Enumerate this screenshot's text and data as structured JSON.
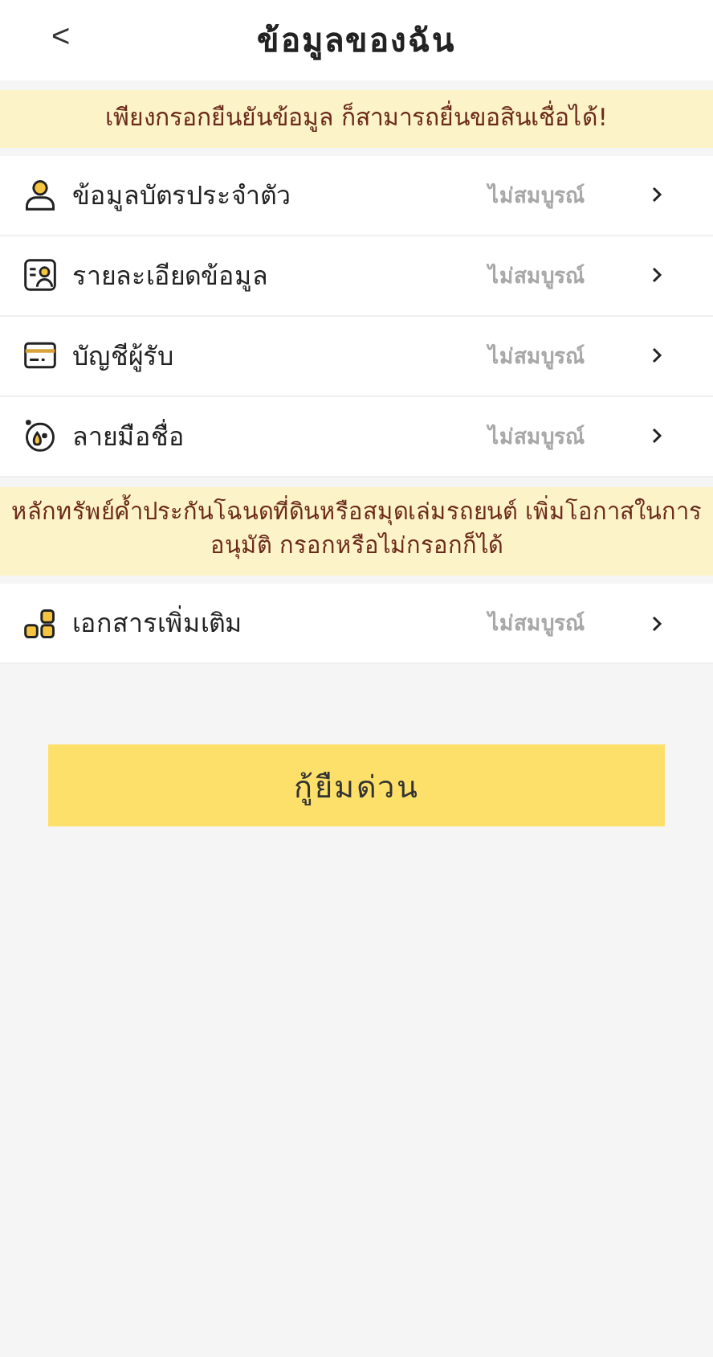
{
  "header": {
    "back": "<",
    "title": "ข้อมูลของฉัน"
  },
  "notice": "เพียงกรอกยืนยันข้อมูล ก็สามารถยื่นขอสินเชื่อได้!",
  "items": [
    {
      "kind": "person",
      "label": "ข้อมูลบัตรประจำตัว",
      "status": "ไม่สมบูรณ์"
    },
    {
      "kind": "profile",
      "label": "รายละเอียดข้อมูล",
      "status": "ไม่สมบูรณ์"
    },
    {
      "kind": "card",
      "label": "บัญชีผู้รับ",
      "status": "ไม่สมบูรณ์"
    },
    {
      "kind": "signature",
      "label": "ลายมือชื่อ",
      "status": "ไม่สมบูรณ์"
    }
  ],
  "collateral_notice": "หลักทรัพย์ค้ำประกันโฉนดที่ดินหรือสมุดเล่มรถยนต์ เพิ่มโอกาสในการอนุมัติ กรอกหรือไม่กรอกก็ได้",
  "extra_items": [
    {
      "kind": "blocks",
      "label": "เอกสารเพิ่มเติม",
      "status": "ไม่สมบูรณ์"
    }
  ],
  "submit": "กู้ยืมด่วน"
}
